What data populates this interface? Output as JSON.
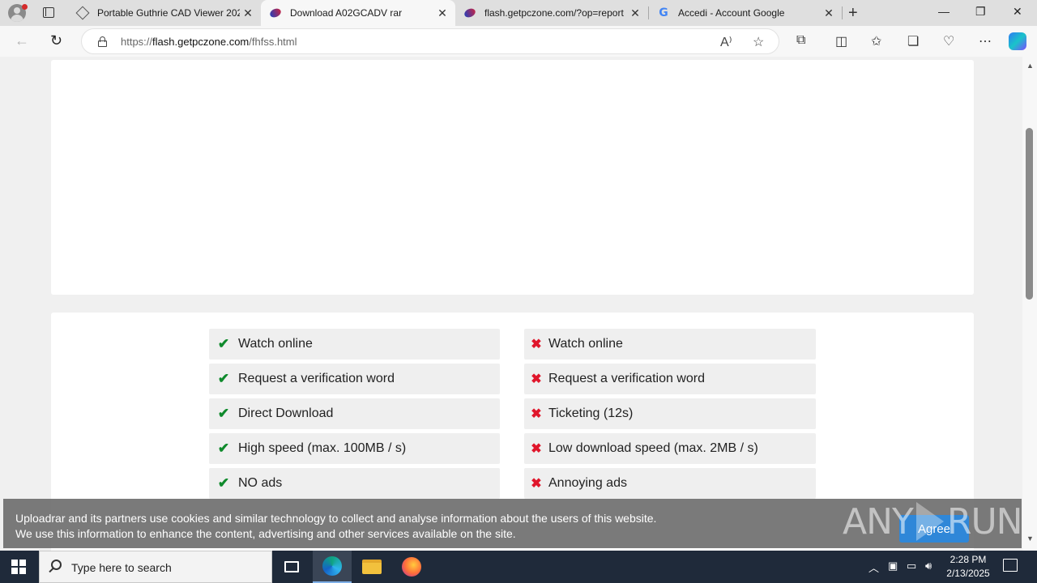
{
  "browser": {
    "tabs": [
      {
        "title": "Portable Guthrie CAD Viewer 202",
        "favicon": "cad-icon",
        "active": false
      },
      {
        "title": "Download A02GCADV rar",
        "favicon": "site-swoosh-icon",
        "active": true
      },
      {
        "title": "flash.getpczone.com/?op=report",
        "favicon": "site-swoosh-icon",
        "active": false
      },
      {
        "title": "Accedi - Account Google",
        "favicon": "google-icon",
        "active": false
      }
    ],
    "url_prefix": "https://",
    "url_host": "flash.getpczone.com",
    "url_path": "/fhfss.html"
  },
  "features": {
    "premium": [
      "Watch online",
      "Request a verification word",
      "Direct Download",
      "High speed (max. 100MB / s)",
      "NO ads"
    ],
    "free": [
      "Watch online",
      "Request a verification word",
      "Ticketing (12s)",
      "Low download speed (max. 2MB / s)",
      "Annoying ads"
    ]
  },
  "cookie_banner": {
    "line1": "Uploadrar and its partners use cookies and similar technology to collect and analyse information about the users of this website.",
    "line2": "We use this information to enhance the content, advertising and other services available on the site.",
    "agree_label": "Agree"
  },
  "watermark": {
    "left": "ANY",
    "right": "RUN"
  },
  "taskbar": {
    "search_placeholder": "Type here to search",
    "time": "2:28 PM",
    "date": "2/13/2025"
  },
  "colors": {
    "check": "#0f8a2c",
    "cross": "#e0162b",
    "agree_button": "#2f87d8",
    "taskbar": "#1f2a3a"
  }
}
